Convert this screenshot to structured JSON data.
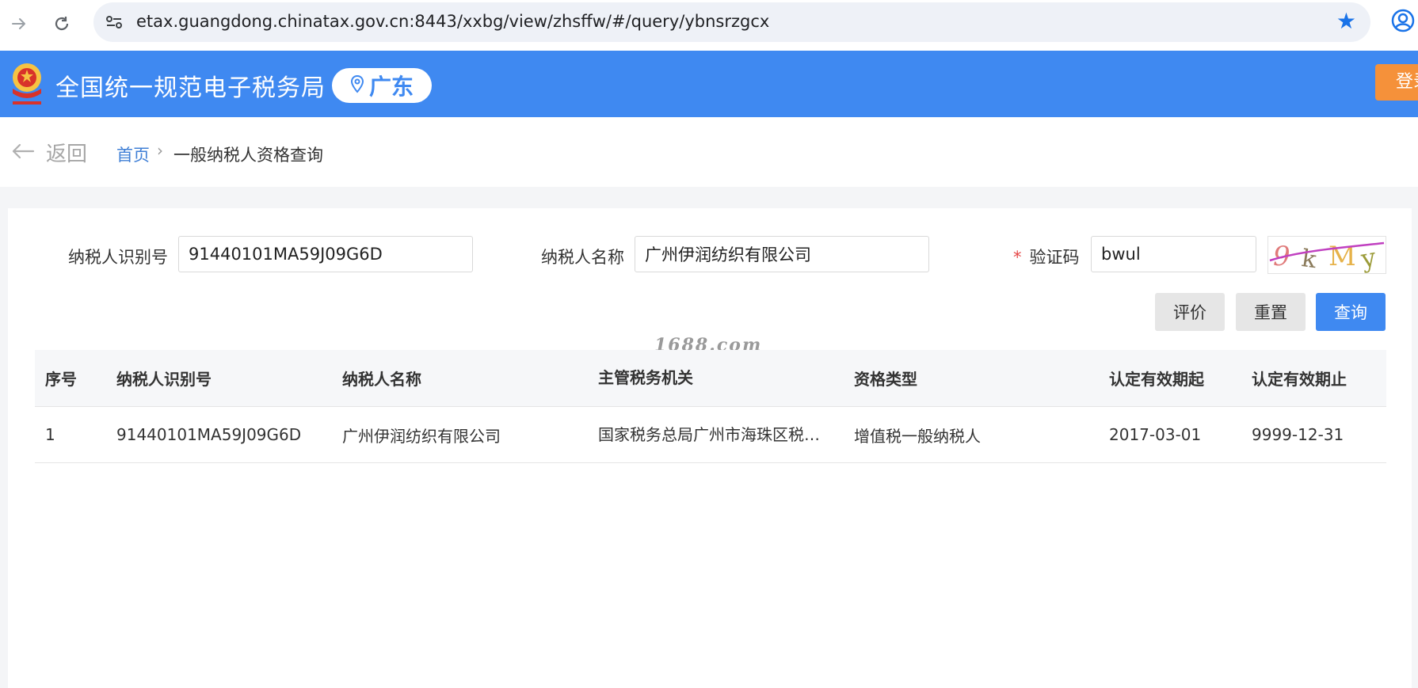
{
  "browser": {
    "url": "etax.guangdong.chinatax.gov.cn:8443/xxbg/view/zhsffw/#/query/ybnsrzgcx"
  },
  "header": {
    "title": "全国统一规范电子税务局",
    "region": "广东",
    "login_label": "登录",
    "colors": {
      "primary": "#3f89f1",
      "login": "#f5913a"
    }
  },
  "breadcrumb": {
    "back_label": "返回",
    "home": "首页",
    "separator": "›",
    "current": "一般纳税人资格查询"
  },
  "form": {
    "taxpayer_id_label": "纳税人识别号",
    "taxpayer_id_value": "91440101MA59J09G6D",
    "taxpayer_name_label": "纳税人名称",
    "taxpayer_name_value": "广州伊润纺织有限公司",
    "captcha_required_mark": "*",
    "captcha_label": "验证码",
    "captcha_value": "bwul",
    "captcha_image_text": "9kMy"
  },
  "buttons": {
    "evaluate": "评价",
    "reset": "重置",
    "query": "查询"
  },
  "watermark": "1688.com",
  "table": {
    "columns": [
      "序号",
      "纳税人识别号",
      "纳税人名称",
      "主管税务机关",
      "资格类型",
      "认定有效期起",
      "认定有效期止"
    ],
    "rows": [
      [
        "1",
        "91440101MA59J09G6D",
        "广州伊润纺织有限公司",
        "国家税务总局广州市海珠区税务局",
        "增值税一般纳税人",
        "2017-03-01",
        "9999-12-31"
      ]
    ]
  }
}
